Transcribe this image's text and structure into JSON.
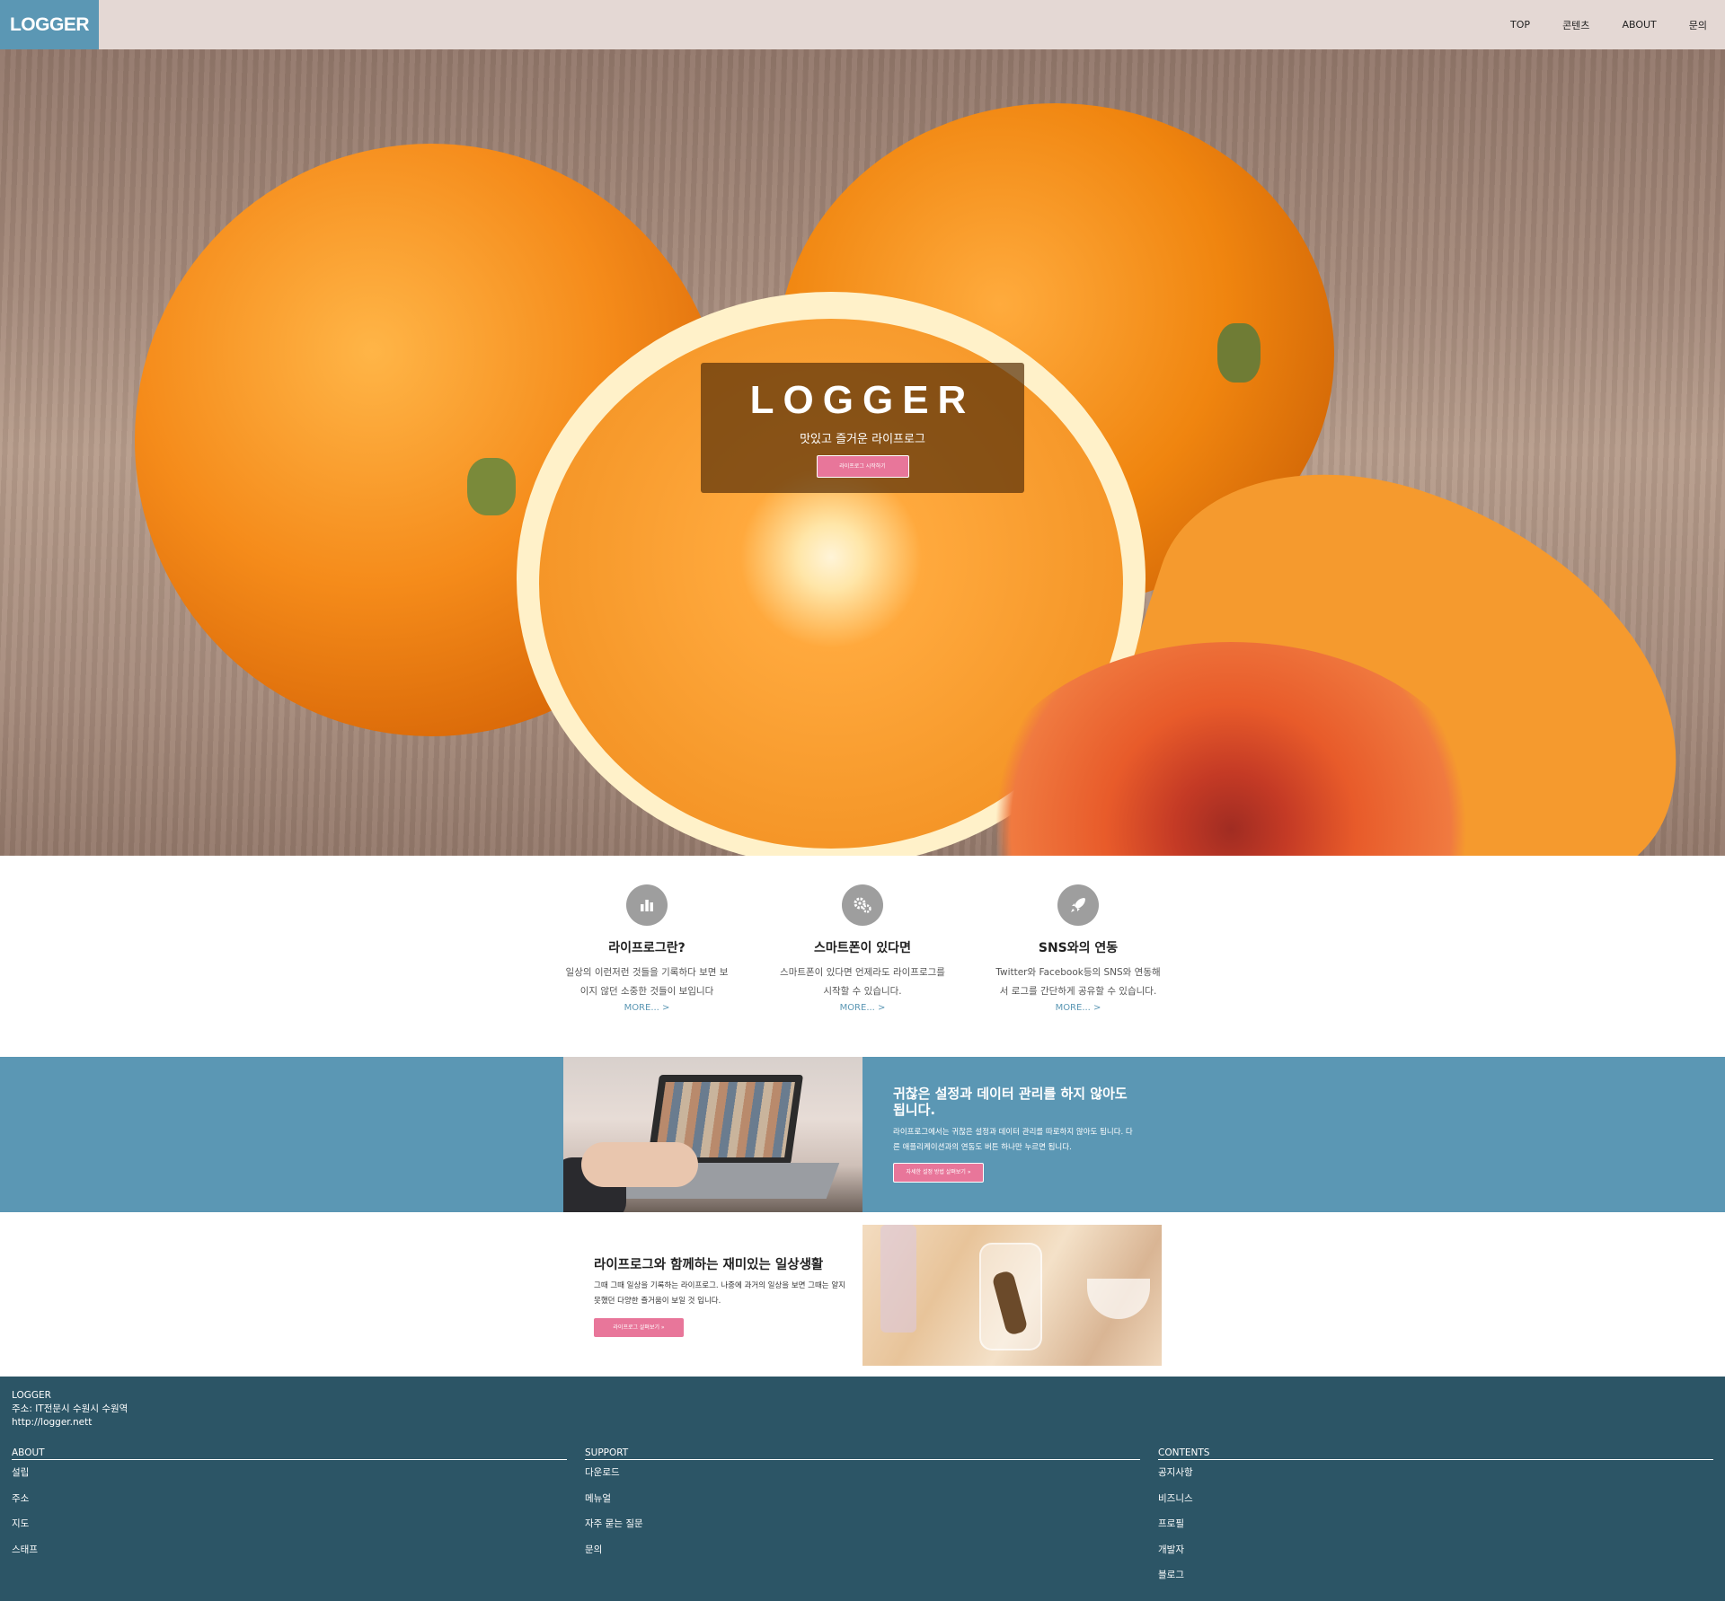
{
  "header": {
    "logo": "LOGGER",
    "nav": [
      "TOP",
      "콘텐츠",
      "ABOUT",
      "문의"
    ]
  },
  "hero": {
    "title": "LOGGER",
    "subtitle": "맛있고 즐거운 라이프로그",
    "button": "라이프로그 시작하기"
  },
  "features": [
    {
      "icon": "bar-chart-icon",
      "title": "라이프로그란?",
      "text": "일상의 이런저런 것들을 기록하다 보면 보이지 않던 소중한 것들이 보입니다",
      "more": "MORE... >"
    },
    {
      "icon": "gears-icon",
      "title": "스마트폰이 있다면",
      "text": "스마트폰이 있다면 언제라도 라이프로그를 시작할 수 있습니다.",
      "more": "MORE... >"
    },
    {
      "icon": "rocket-icon",
      "title": "SNS와의 연동",
      "text": "Twitter와 Facebook등의 SNS와 연동해서 로그를 간단하게 공유할 수 있습니다.",
      "more": "MORE... >"
    }
  ],
  "band": {
    "title": "귀찮은 설정과 데이터 관리를 하지 않아도 됩니다.",
    "text": "라이프로그에서는 귀찮은 설정과 데이터 관리를 따로하지 않아도 됩니다. 다른 애플리케이션과의 연동도 버튼 하나만 누르면 됩니다.",
    "button": "자세한 설정 방법 살펴보기 »"
  },
  "life": {
    "title": "라이프로그와 함께하는 재미있는 일상생활",
    "text": "그때 그때 일상을 기록하는 라이프로그. 나중에 과거의 일상을 보면 그때는 알지 못했던 다양한 즐거움이 보일 것 입니다.",
    "button": "라이프로그 살펴보기 »"
  },
  "footer": {
    "brand": "LOGGER",
    "address": "주소: IT전문시 수원시 수원역",
    "url": "http://logger.nett",
    "columns": [
      {
        "title": "ABOUT",
        "items": [
          "설립",
          "주소",
          "지도",
          "스태프"
        ]
      },
      {
        "title": "SUPPORT",
        "items": [
          "다운로드",
          "메뉴얼",
          "자주 묻는 질문",
          "문의"
        ]
      },
      {
        "title": "CONTENTS",
        "items": [
          "공지사항",
          "비즈니스",
          "프로필",
          "개발자",
          "블로그"
        ]
      }
    ]
  },
  "colors": {
    "accent": "#5b97b4",
    "button": "#e8769a",
    "footer": "#2c5566",
    "header": "#e4d8d4"
  }
}
